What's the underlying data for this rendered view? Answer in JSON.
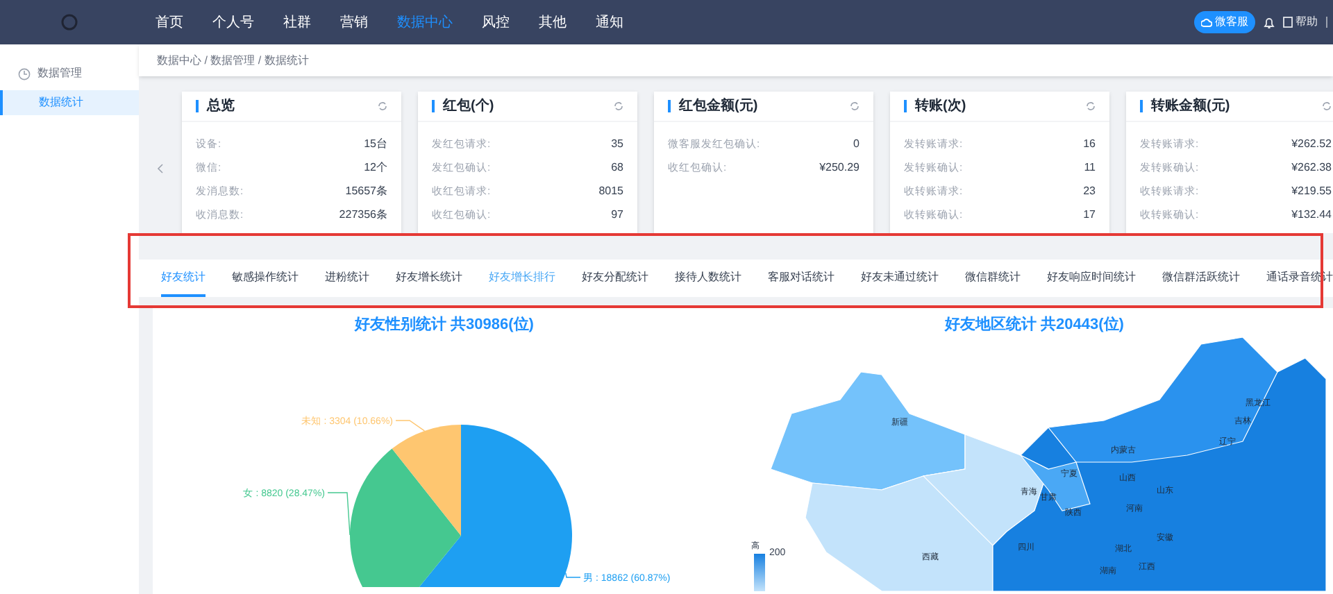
{
  "top_nav": {
    "items": [
      {
        "label": "首页",
        "selected": false
      },
      {
        "label": "个人号",
        "selected": false
      },
      {
        "label": "社群",
        "selected": false
      },
      {
        "label": "营销",
        "selected": false
      },
      {
        "label": "数据中心",
        "selected": true
      },
      {
        "label": "风控",
        "selected": false
      },
      {
        "label": "其他",
        "selected": false
      },
      {
        "label": "通知",
        "selected": false
      }
    ],
    "service_button": "微客服",
    "help_link": "帮助"
  },
  "sidebar": {
    "group": "数据管理",
    "items": [
      {
        "label": "数据统计",
        "selected": true
      }
    ]
  },
  "breadcrumb": "数据中心 / 数据管理 / 数据统计",
  "cards": [
    {
      "title": "总览",
      "rows": [
        {
          "label": "设备:",
          "value": "15台"
        },
        {
          "label": "微信:",
          "value": "12个"
        },
        {
          "label": "发消息数:",
          "value": "15657条"
        },
        {
          "label": "收消息数:",
          "value": "227356条"
        }
      ]
    },
    {
      "title": "红包(个)",
      "rows": [
        {
          "label": "发红包请求:",
          "value": "35"
        },
        {
          "label": "发红包确认:",
          "value": "68"
        },
        {
          "label": "收红包请求:",
          "value": "8015"
        },
        {
          "label": "收红包确认:",
          "value": "97"
        }
      ]
    },
    {
      "title": "红包金额(元)",
      "rows": [
        {
          "label": "微客服发红包确认:",
          "value": "0"
        },
        {
          "label": "收红包确认:",
          "value": "¥250.29"
        }
      ]
    },
    {
      "title": "转账(次)",
      "rows": [
        {
          "label": "发转账请求:",
          "value": "16"
        },
        {
          "label": "发转账确认:",
          "value": "11"
        },
        {
          "label": "收转账请求:",
          "value": "23"
        },
        {
          "label": "收转账确认:",
          "value": "17"
        }
      ]
    },
    {
      "title": "转账金额(元)",
      "rows": [
        {
          "label": "发转账请求:",
          "value": "¥262.52"
        },
        {
          "label": "发转账确认:",
          "value": "¥262.38"
        },
        {
          "label": "收转账请求:",
          "value": "¥219.55"
        },
        {
          "label": "收转账确认:",
          "value": "¥132.44"
        }
      ]
    }
  ],
  "tabs": [
    {
      "label": "好友统计",
      "selected": true,
      "hovered": false
    },
    {
      "label": "敏感操作统计",
      "selected": false,
      "hovered": false
    },
    {
      "label": "进粉统计",
      "selected": false,
      "hovered": false
    },
    {
      "label": "好友增长统计",
      "selected": false,
      "hovered": false
    },
    {
      "label": "好友增长排行",
      "selected": false,
      "hovered": true
    },
    {
      "label": "好友分配统计",
      "selected": false,
      "hovered": false
    },
    {
      "label": "接待人数统计",
      "selected": false,
      "hovered": false
    },
    {
      "label": "客服对话统计",
      "selected": false,
      "hovered": false
    },
    {
      "label": "好友未通过统计",
      "selected": false,
      "hovered": false
    },
    {
      "label": "微信群统计",
      "selected": false,
      "hovered": false
    },
    {
      "label": "好友响应时间统计",
      "selected": false,
      "hovered": false
    },
    {
      "label": "微信群活跃统计",
      "selected": false,
      "hovered": false
    },
    {
      "label": "通话录音统计",
      "selected": false,
      "hovered": false
    }
  ],
  "gender_chart": {
    "title": "好友性别统计 共30986(位)",
    "chart_data": {
      "type": "pie",
      "categories": [
        "男",
        "女",
        "未知"
      ],
      "values": [
        18862,
        8820,
        3304
      ],
      "colors": [
        "#1e9ff2",
        "#45c890",
        "#fec670"
      ],
      "value_labels": [
        ": 18862 (60.87%)",
        ": 8820 (28.47%)",
        ": 3304 (10.66%)"
      ]
    }
  },
  "region_chart": {
    "title": "好友地区统计 共20443(位)",
    "region_labels": [
      "新疆",
      "西藏",
      "青海",
      "甘肃",
      "宁夏",
      "内蒙古",
      "黑龙江",
      "吉林",
      "辽宁",
      "山西",
      "山东",
      "陕西",
      "河南",
      "四川",
      "湖北",
      "安徽",
      "湖南",
      "江西"
    ],
    "legend": {
      "high_label": "高",
      "max_label": "200"
    }
  }
}
